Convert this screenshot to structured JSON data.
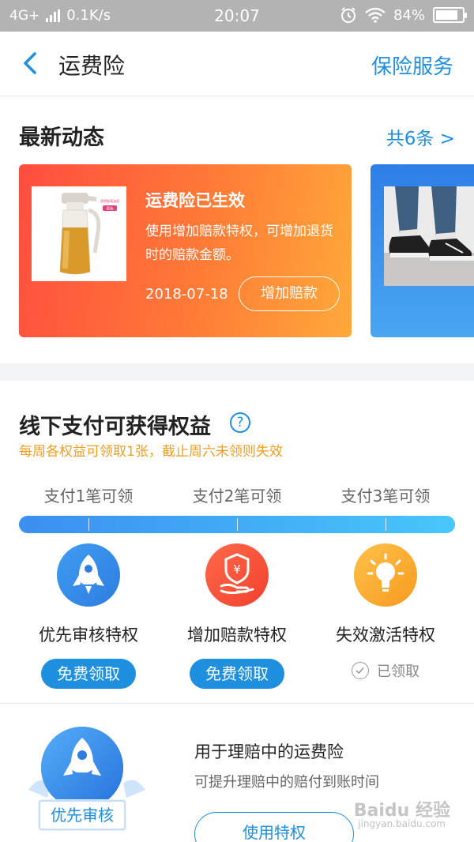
{
  "status_bar": {
    "network": "4G+",
    "speed": "0.1K/s",
    "time": "20:07",
    "battery": "84%",
    "battery_level": 0.84,
    "icons": [
      "signal-icon",
      "alarm-icon",
      "wifi-icon",
      "battery-icon"
    ]
  },
  "nav": {
    "title": "运费险",
    "action": "保险服务",
    "back_icon": "chevron-left-icon"
  },
  "latest": {
    "title": "最新动态",
    "more": "共6条 >",
    "card": {
      "title": "运费险已生效",
      "desc": "使用增加赔款特权，可增加退货时的赔款金额。",
      "date": "2018-07-18",
      "button": "增加赔款",
      "image_label": "透明玻璃油壶",
      "image_tag": "原色"
    }
  },
  "benefits": {
    "title": "线下支付可获得权益",
    "help": "?",
    "subtitle": "每周各权益可领取1张，截止周六未领则失效",
    "steps": [
      "支付1笔可领",
      "支付2笔可领",
      "支付3笔可领"
    ],
    "items": [
      {
        "name": "优先审核特权",
        "action": "免费领取",
        "claimed": false,
        "icon": "rocket-icon"
      },
      {
        "name": "增加赔款特权",
        "action": "免费领取",
        "claimed": false,
        "icon": "money-shield-icon"
      },
      {
        "name": "失效激活特权",
        "action": "已领取",
        "claimed": true,
        "icon": "lightbulb-icon"
      }
    ]
  },
  "privilege": {
    "badge": "优先审核",
    "title": "用于理赔中的运费险",
    "desc": "可提升理赔中的赔付到账时间",
    "button": "使用特权"
  },
  "watermark": {
    "brand": "Baidu 经验",
    "url": "jingyan.baidu.com"
  },
  "colors": {
    "accent": "#1f8fe0",
    "card_gradient_start": "#ff4d3f",
    "card_gradient_end": "#ffa93a",
    "notice": "#f59d1c"
  }
}
